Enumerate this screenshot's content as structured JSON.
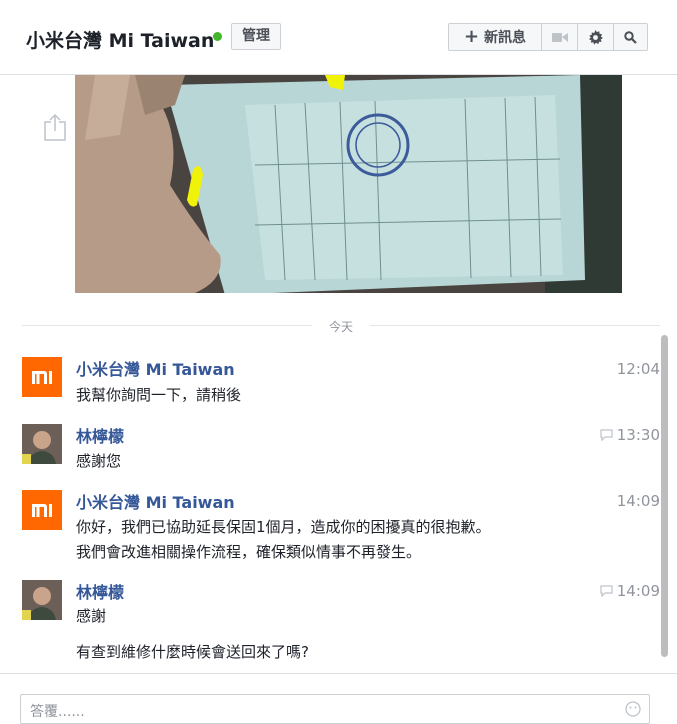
{
  "header": {
    "title": "小米台灣 Mi Taiwan",
    "manage_label": "管理",
    "new_message_label": "新訊息",
    "online_color": "#42b72a"
  },
  "icons": {
    "plus": "plus-icon",
    "video": "video-camera-icon",
    "settings": "gear-icon",
    "search": "search-icon",
    "share": "share-icon",
    "seen": "seen-chat-icon",
    "emoji": "emoji-icon"
  },
  "day_separator": "今天",
  "messages": [
    {
      "sender": "小米台灣 Mi Taiwan",
      "avatar": "mi-logo",
      "lines": [
        "我幫你詢問一下，請稍後"
      ],
      "time": "12:04",
      "seen_icon": false
    },
    {
      "sender": "林檸檬",
      "avatar": "user-photo",
      "lines": [
        "感謝您"
      ],
      "time": "13:30",
      "seen_icon": true
    },
    {
      "sender": "小米台灣 Mi Taiwan",
      "avatar": "mi-logo",
      "lines": [
        "你好，我們已協助延長保固1個月，造成你的困擾真的很抱歉。",
        "我們會改進相關操作流程，確保類似情事不再發生。"
      ],
      "time": "14:09",
      "seen_icon": false
    },
    {
      "sender": "林檸檬",
      "avatar": "user-photo",
      "lines": [
        "感謝",
        "有查到維修什麼時候會送回來了嗎?"
      ],
      "time": "14:09",
      "seen_icon": true
    }
  ],
  "reply": {
    "placeholder": "答覆......"
  },
  "colors": {
    "sender": "#365899",
    "mi_brand": "#ff6700",
    "border": "#dddfe2"
  }
}
